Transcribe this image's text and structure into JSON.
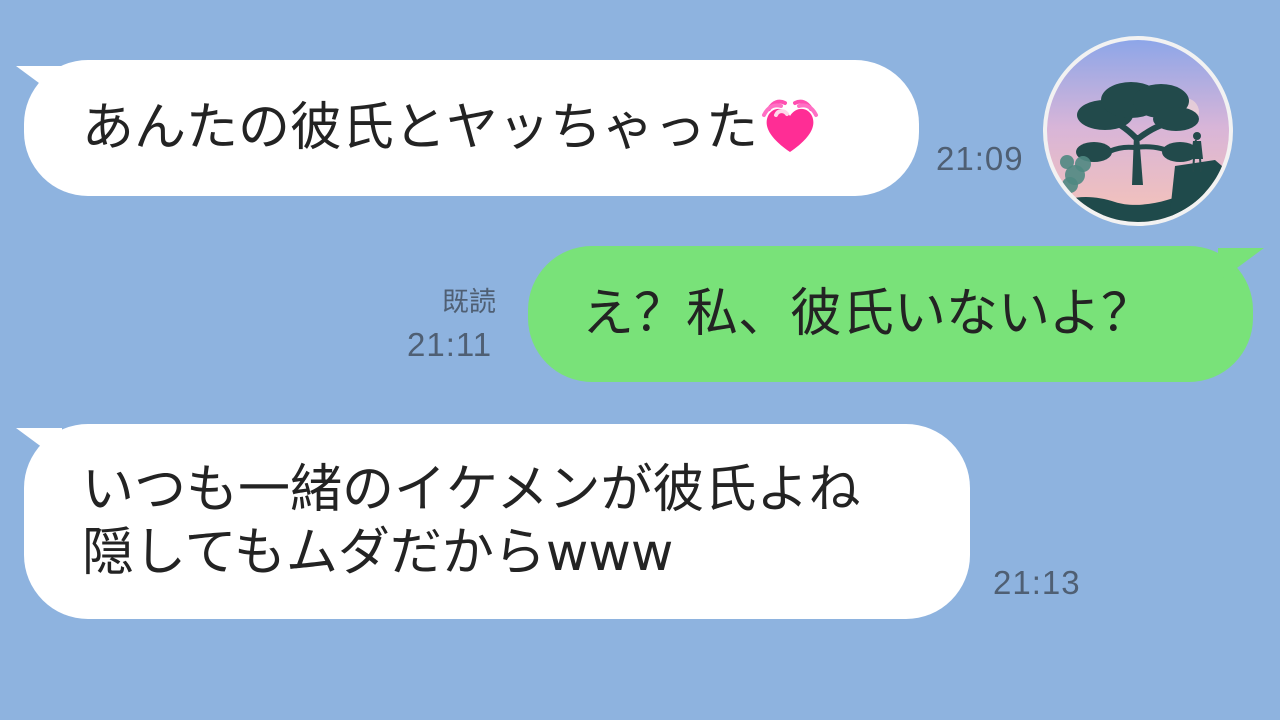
{
  "conversation": {
    "messages": [
      {
        "side": "incoming",
        "text": "あんたの彼氏とヤッちゃった",
        "emoji": "beating-heart-icon",
        "time": "21:09"
      },
      {
        "side": "outgoing",
        "text": "え？私、彼氏いないよ？",
        "status": "既読",
        "time": "21:11"
      },
      {
        "side": "incoming",
        "lines": [
          "いつも一緒のイケメンが彼氏よね",
          "隠してもムダだからwww"
        ],
        "time": "21:13"
      }
    ]
  },
  "avatar": {
    "icon": "silhouette-tree-avatar-icon"
  },
  "colors": {
    "background": "#8eb3df",
    "incoming_bubble": "#ffffff",
    "outgoing_bubble": "#79e279",
    "meta_text": "#4f5f73"
  }
}
